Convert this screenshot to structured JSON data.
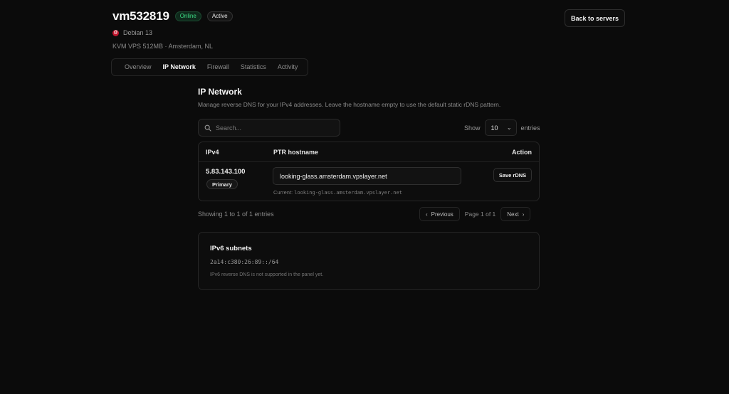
{
  "server": {
    "name": "vm532819",
    "status_badge": "Online",
    "state_badge": "Active",
    "os_icon": "debian-icon",
    "os_name": "Debian 13",
    "plan_location": "KVM VPS 512MB · Amsterdam, NL",
    "back_label": "Back to servers"
  },
  "tabs": [
    {
      "label": "Overview",
      "active": false
    },
    {
      "label": "IP Network",
      "active": true
    },
    {
      "label": "Firewall",
      "active": false
    },
    {
      "label": "Statistics",
      "active": false
    },
    {
      "label": "Activity",
      "active": false
    }
  ],
  "section": {
    "title": "IP Network",
    "description": "Manage reverse DNS for your IPv4 addresses. Leave the hostname empty to use the default static rDNS pattern."
  },
  "search": {
    "placeholder": "Search...",
    "icon": "search-icon"
  },
  "page_size": {
    "show_label": "Show",
    "value": "10",
    "entries_label": "entries"
  },
  "table": {
    "columns": [
      "IPv4",
      "PTR hostname",
      "Action"
    ],
    "rows": [
      {
        "ip": "5.83.143.100",
        "badge": "Primary",
        "ptr_value": "looking-glass.amsterdam.vpslayer.net",
        "current_label": "Current:",
        "current_value": "looking-glass.amsterdam.vpslayer.net",
        "action_label": "Save rDNS"
      }
    ]
  },
  "pagination": {
    "showing_text": "Showing 1 to 1 of 1 entries",
    "previous_label": "Previous",
    "page_info": "Page 1 of 1",
    "next_label": "Next"
  },
  "ipv6": {
    "title": "IPv6 subnets",
    "subnet": "2a14:c380:26:89::/64",
    "note": "IPv6 reverse DNS is not supported in the panel yet."
  },
  "colors": {
    "background": "#0b0b0b",
    "online_green": "#3ddc84",
    "debian_red": "#c0152d"
  }
}
